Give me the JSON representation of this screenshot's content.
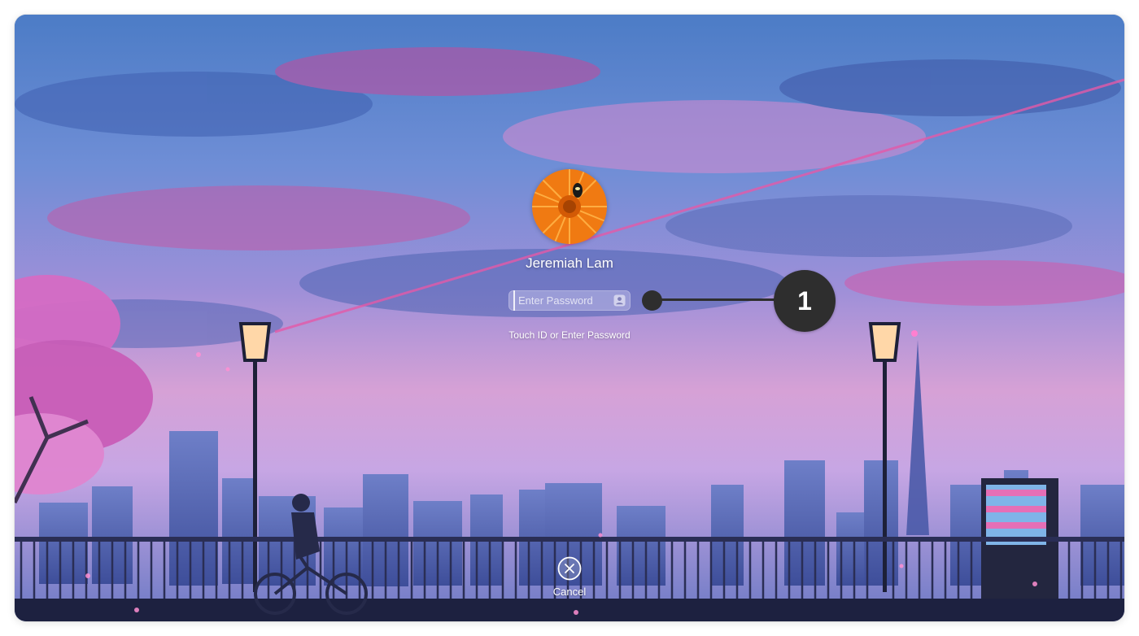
{
  "login": {
    "user_name": "Jeremiah Lam",
    "password_placeholder": "Enter Password",
    "password_value": "",
    "hint": "Touch ID or Enter Password",
    "cancel_label": "Cancel"
  },
  "callout": {
    "number": "1"
  },
  "icons": {
    "avatar": "gerbera-flower-avatar",
    "password_assist": "contact-card-icon",
    "cancel": "close-circle-icon"
  },
  "colors": {
    "callout": "#2e2e2e",
    "avatar_petals": "#f07a12"
  }
}
